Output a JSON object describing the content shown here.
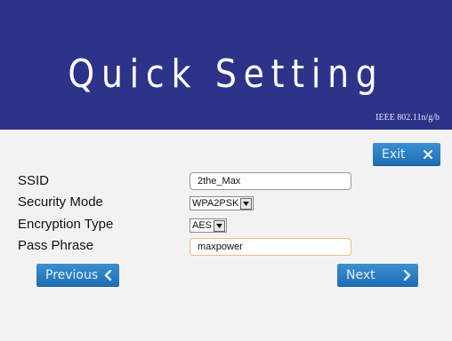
{
  "header": {
    "title": "Quick Setting",
    "standard": "IEEE 802.11n/g/b",
    "bg_color": "#2e338a"
  },
  "buttons": {
    "exit_label": "Exit",
    "previous_label": "Previous",
    "next_label": "Next",
    "accent_color": "#2a7fc4"
  },
  "form": {
    "ssid": {
      "label": "SSID",
      "value": "2the_Max"
    },
    "security_mode": {
      "label": "Security Mode",
      "value": "WPA2PSK"
    },
    "encryption_type": {
      "label": "Encryption Type",
      "value": "AES"
    },
    "pass_phrase": {
      "label": "Pass Phrase",
      "value": "maxpower"
    }
  }
}
